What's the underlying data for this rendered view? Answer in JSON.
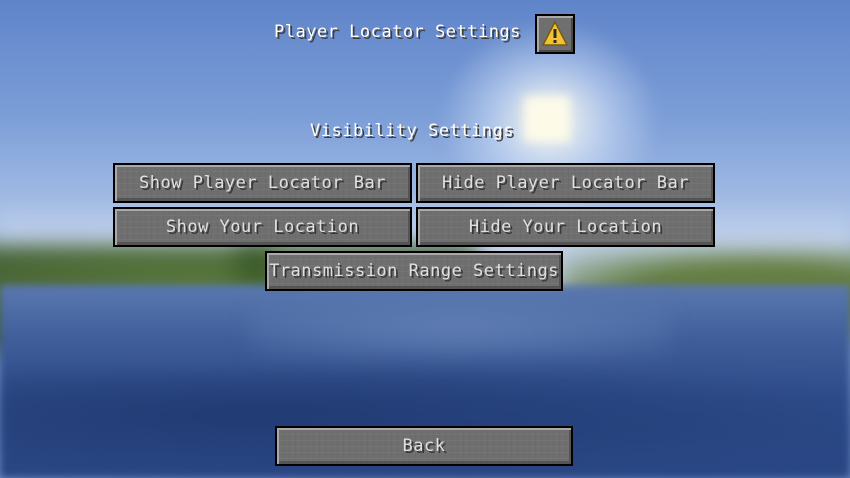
{
  "screen": {
    "title": "Player Locator Settings",
    "section_heading": "Visibility Settings"
  },
  "warning_button": {
    "icon": "warning-icon",
    "icon_color": "#f2c230"
  },
  "buttons": {
    "show_locator_bar": "Show Player Locator Bar",
    "hide_locator_bar": "Hide Player Locator Bar",
    "show_location": "Show Your Location",
    "hide_location": "Hide Your Location",
    "transmission_range": "Transmission Range Settings",
    "back": "Back"
  },
  "colors": {
    "button_face": "#6f6f6f",
    "text": "#ffffff"
  }
}
